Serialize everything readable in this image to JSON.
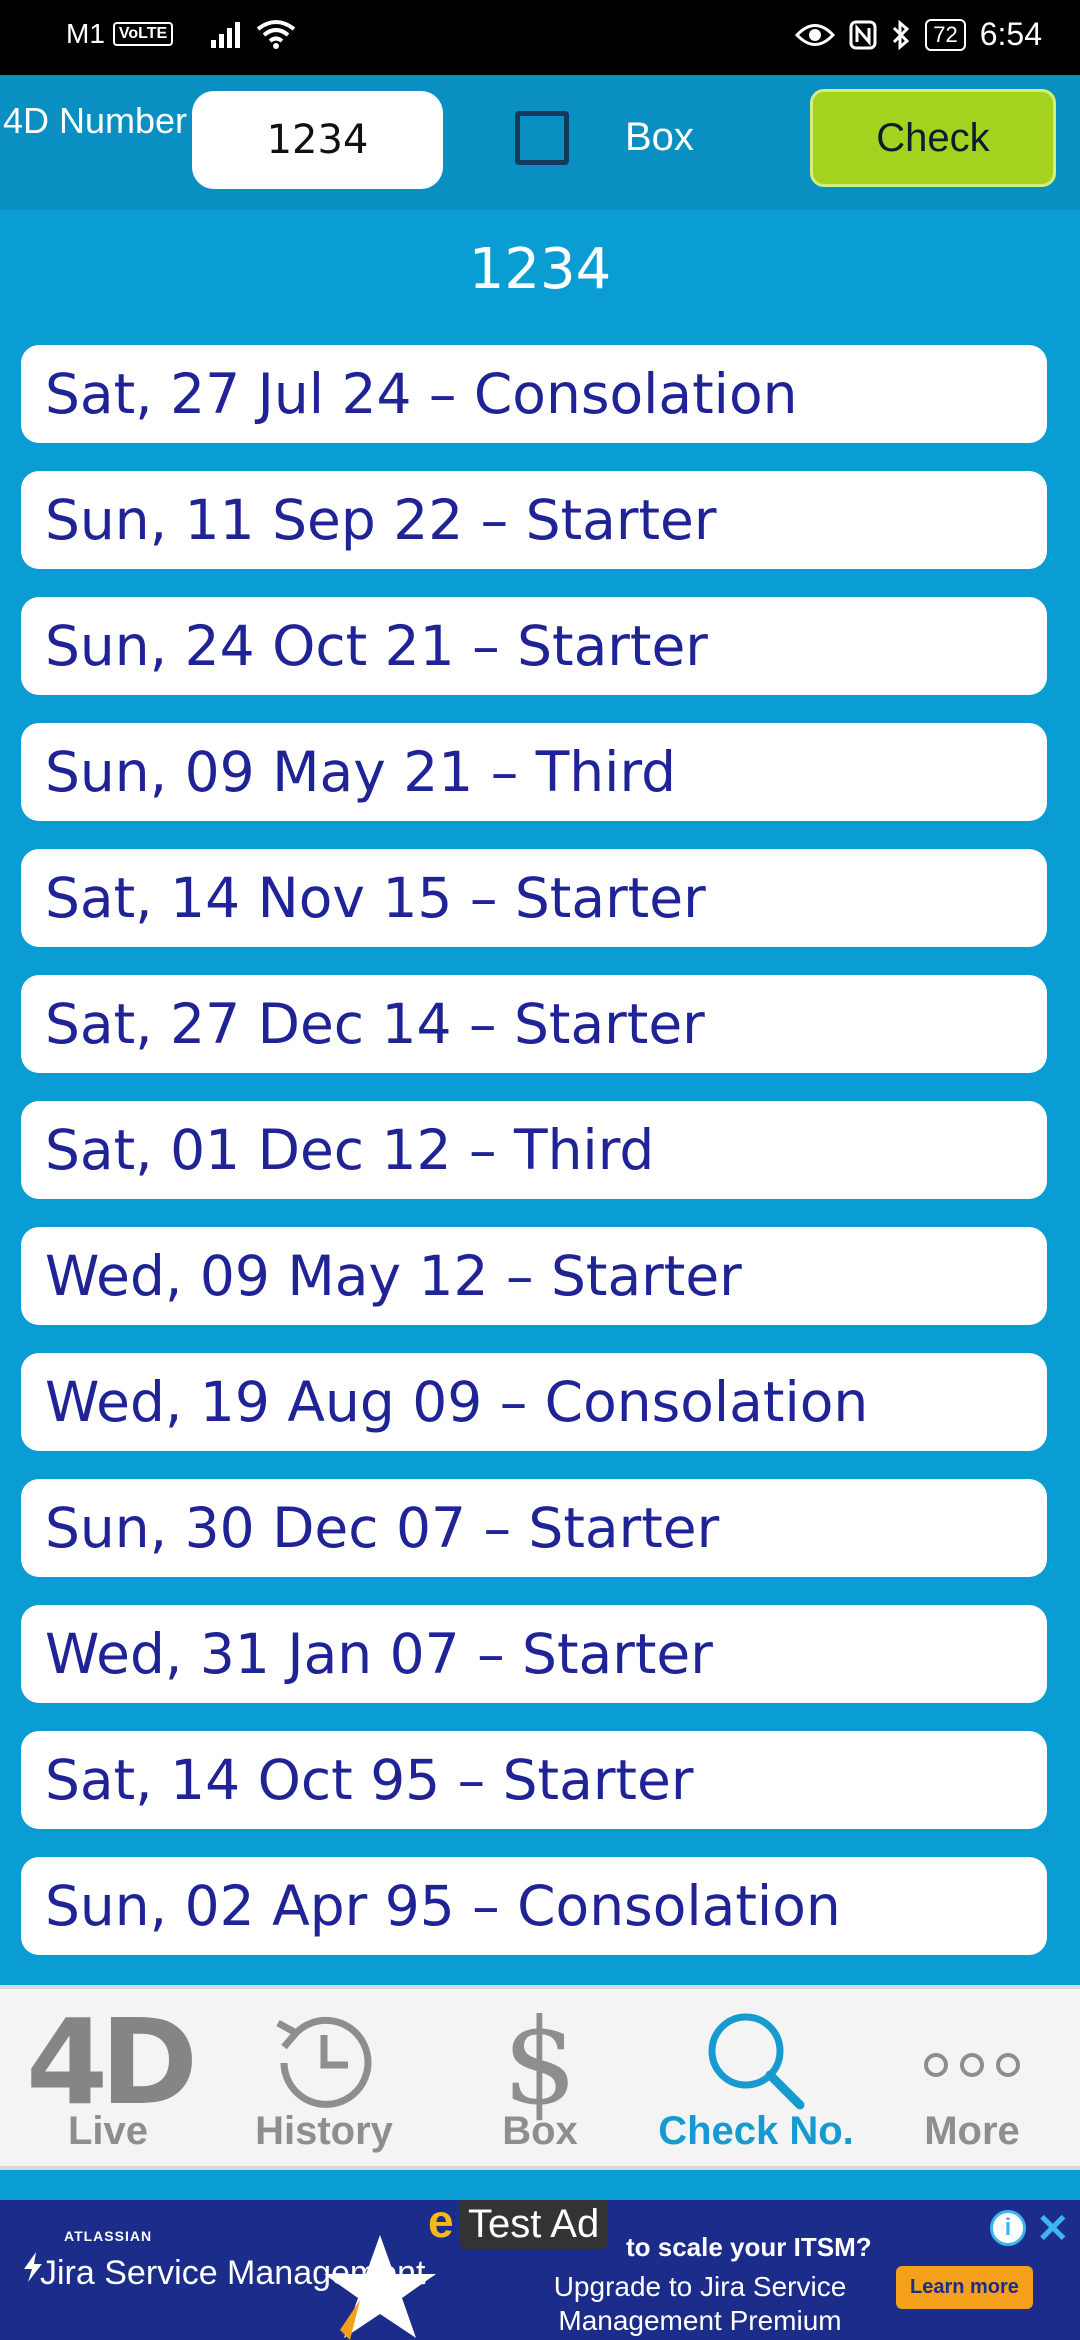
{
  "status_bar": {
    "carrier": "M1",
    "volte": "VoLTE",
    "battery": "72",
    "time": "6:54"
  },
  "header": {
    "label": "4D Number",
    "number_value": "1234",
    "number_placeholder": "",
    "box_label": "Box",
    "box_checked": false,
    "check_label": "Check"
  },
  "result_title": "1234",
  "results": [
    "Sat, 27 Jul 24 – Consolation",
    "Sun, 11 Sep 22 – Starter",
    "Sun, 24 Oct 21 – Starter",
    "Sun, 09 May 21 – Third",
    "Sat, 14 Nov 15 – Starter",
    "Sat, 27 Dec 14 – Starter",
    "Sat, 01 Dec 12 – Third",
    "Wed, 09 May 12 – Starter",
    "Wed, 19 Aug 09 – Consolation",
    "Sun, 30 Dec 07 – Starter",
    "Wed, 31 Jan 07 – Starter",
    "Sat, 14 Oct 95 – Starter",
    "Sun, 02 Apr 95 – Consolation"
  ],
  "tabs": [
    {
      "label": "Live",
      "icon": "4d-logo-icon"
    },
    {
      "label": "History",
      "icon": "history-icon"
    },
    {
      "label": "Box",
      "icon": "dollar-icon"
    },
    {
      "label": "Check No.",
      "icon": "search-icon",
      "active": true
    },
    {
      "label": "More",
      "icon": "more-dots-icon"
    }
  ],
  "icon_4d_text": "4D",
  "icon_dollar_text": "$",
  "ad": {
    "brand_small": "ATLASSIAN",
    "brand": "Jira Service Management",
    "test_badge": "Test Ad",
    "tagline": "to scale your ITSM?",
    "subtitle": "Upgrade to Jira Service Management Premium",
    "cta": "Learn more"
  },
  "colors": {
    "background": "#0a9dd3",
    "header": "#0a8fc2",
    "check_button": "#a4d21e",
    "result_text": "#1f2396",
    "active_tab": "#179ad0"
  }
}
